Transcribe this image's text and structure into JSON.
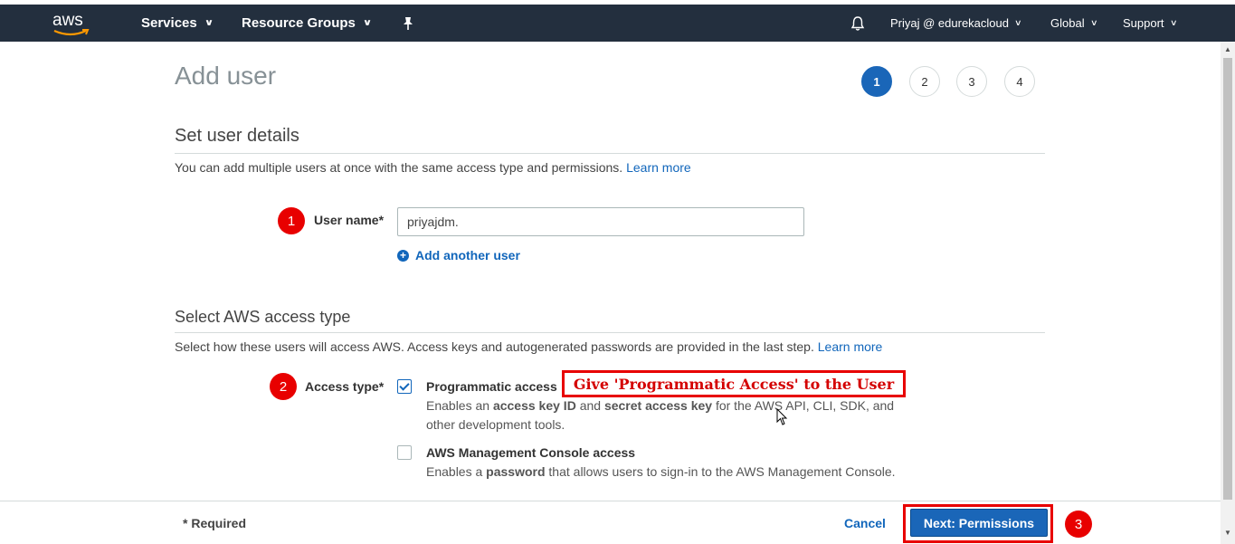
{
  "nav": {
    "logo": "aws",
    "services": "Services",
    "resource_groups": "Resource Groups",
    "account": "Priyaj @ edurekacloud",
    "region": "Global",
    "support": "Support"
  },
  "page": {
    "title": "Add user",
    "steps": [
      "1",
      "2",
      "3",
      "4"
    ],
    "active_step": 1
  },
  "details": {
    "heading": "Set user details",
    "description": "You can add multiple users at once with the same access type and permissions.",
    "learn_more": "Learn more",
    "user_name_label": "User name*",
    "user_name_value": "priyajdm.",
    "add_another": "Add another user"
  },
  "access": {
    "heading": "Select AWS access type",
    "description": "Select how these users will access AWS. Access keys and autogenerated passwords are provided in the last step.",
    "learn_more": "Learn more",
    "label": "Access type*",
    "programmatic": {
      "title": "Programmatic access",
      "desc_pre": "Enables an ",
      "desc_b1": "access key ID",
      "desc_mid": " and ",
      "desc_b2": "secret access key",
      "desc_post": " for the AWS API, CLI, SDK, and other development tools.",
      "checked": true
    },
    "console": {
      "title": "AWS Management Console access",
      "desc_pre": "Enables a ",
      "desc_b": "password",
      "desc_post": " that allows users to sign-in to the AWS Management Console.",
      "checked": false
    }
  },
  "annotations": {
    "badge1": "1",
    "badge2": "2",
    "badge3": "3",
    "note": "Give 'Programmatic Access' to the User"
  },
  "footer": {
    "required": "* Required",
    "cancel": "Cancel",
    "next": "Next: Permissions"
  },
  "colors": {
    "nav_bg": "#232f3e",
    "primary": "#1a66b8",
    "link": "#1166bb",
    "annotation": "#e80000"
  }
}
